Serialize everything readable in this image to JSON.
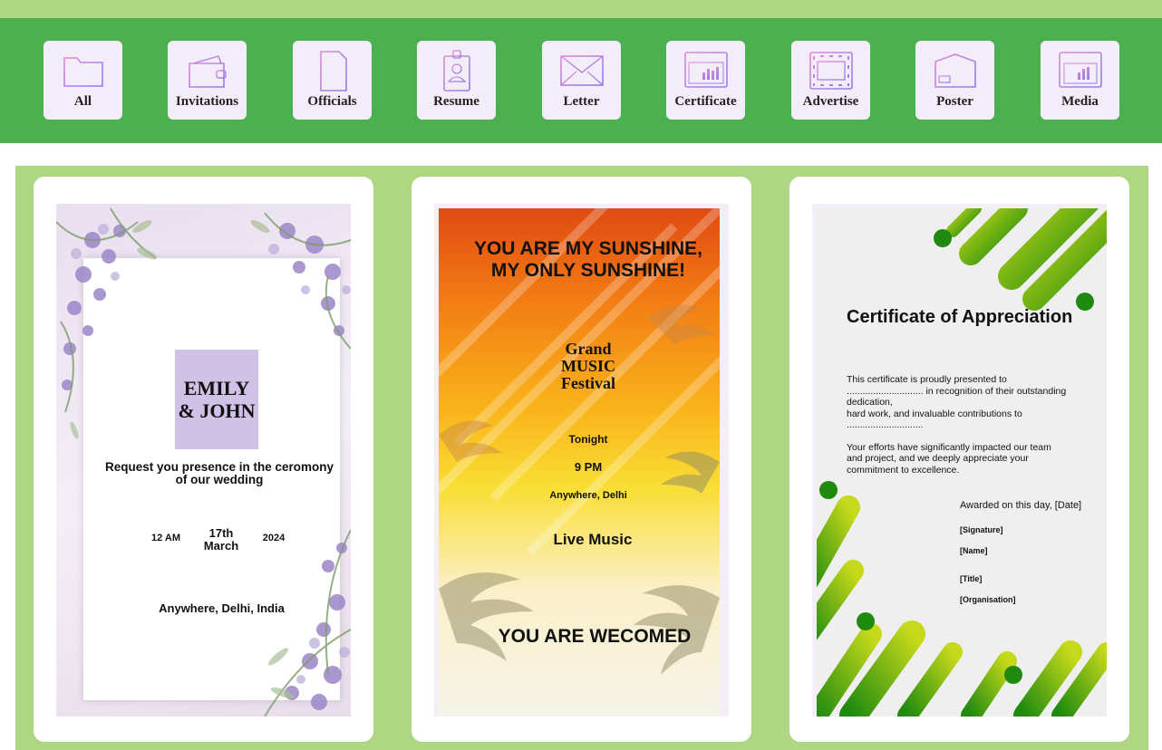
{
  "categories": [
    {
      "label": "All",
      "icon": "folder-icon"
    },
    {
      "label": "Invitations",
      "icon": "wallet-icon"
    },
    {
      "label": "Officials",
      "icon": "document-icon"
    },
    {
      "label": "Resume",
      "icon": "id-badge-icon"
    },
    {
      "label": "Letter",
      "icon": "envelope-icon"
    },
    {
      "label": "Certificate",
      "icon": "chart-window-icon"
    },
    {
      "label": "Advertise",
      "icon": "film-icon"
    },
    {
      "label": "Poster",
      "icon": "package-icon"
    },
    {
      "label": "Media",
      "icon": "media-chart-icon"
    }
  ],
  "templates": {
    "wedding": {
      "names_line1": "EMILY",
      "names_line2": "& JOHN",
      "request_line1": "Request you presence in the ceromony",
      "request_line2": "of our wedding",
      "time": "12 AM",
      "day": "17th",
      "month": "March",
      "year": "2024",
      "location": "Anywhere, Delhi, India"
    },
    "festival": {
      "headline_line1": "YOU ARE MY SUNSHINE,",
      "headline_line2": "MY ONLY SUNSHINE!",
      "event_line1": "Grand",
      "event_line2": "MUSIC",
      "event_line3": "Festival",
      "when": "Tonight",
      "time": "9 PM",
      "where": "Anywhere, Delhi",
      "feature": "Live Music",
      "footer": "YOU ARE WECOMED"
    },
    "certificate": {
      "title": "Certificate of Appreciation",
      "body_line1": "This certificate is proudly presented to",
      "body_line2": "............................. in recognition of their outstanding",
      "body_line3": "dedication,",
      "body_line4": "hard work, and invaluable contributions to",
      "body_line5": ".............................",
      "body_line6": "Your efforts have significantly impacted our team",
      "body_line7": "and project, and we deeply appreciate your",
      "body_line8": "commitment to excellence.",
      "awarded": "Awarded on this day, [Date]",
      "signature": "[Signature]",
      "name": "[Name]",
      "title_field": "[Title]",
      "organisation": "[Organisation]"
    }
  },
  "colors": {
    "header_green": "#4cb050",
    "page_green": "#afd683",
    "button_bg": "#f3ecf9",
    "icon_purple": "#b98ae6",
    "name_box": "#d0c2e6"
  }
}
